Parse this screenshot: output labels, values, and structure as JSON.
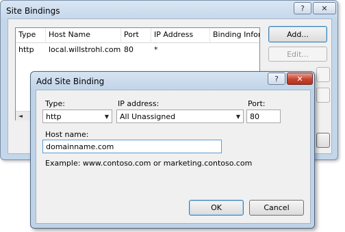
{
  "bindings_window": {
    "title": "Site Bindings",
    "help_label": "?",
    "close_label": "✕",
    "columns": [
      "Type",
      "Host Name",
      "Port",
      "IP Address",
      "Binding Inform"
    ],
    "rows": [
      {
        "type": "http",
        "host": "local.willstrohl.com",
        "port": "80",
        "ip": "*"
      }
    ],
    "scroll_left": "◄",
    "add_label": "Add...",
    "edit_label": "Edit..."
  },
  "dialog": {
    "title": "Add Site Binding",
    "help_label": "?",
    "close_label": "✕",
    "type_label": "Type:",
    "type_value": "http",
    "ip_label": "IP address:",
    "ip_value": "All Unassigned",
    "port_label": "Port:",
    "port_value": "80",
    "host_label": "Host name:",
    "host_value": "domainname.com",
    "example_text": "Example: www.contoso.com or marketing.contoso.com",
    "ok_label": "OK",
    "cancel_label": "Cancel"
  },
  "icons": {
    "dropdown": "chevron-down-icon",
    "close": "close-icon",
    "help": "help-icon"
  }
}
